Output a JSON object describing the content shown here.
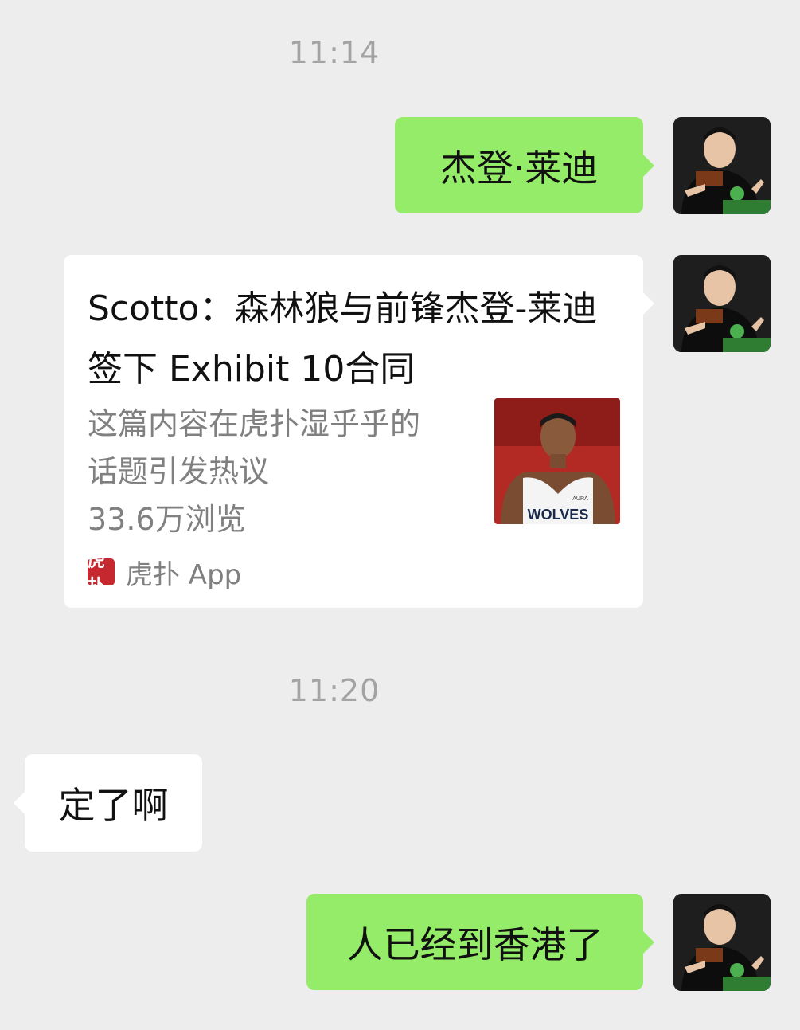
{
  "messages": {
    "timestamp_1": "11:14",
    "msg_1": "杰登·莱迪",
    "card": {
      "title": "Scotto：森林狼与前锋杰登-莱迪签下 Exhibit 10合同",
      "desc_line_1": "这篇内容在虎扑湿乎乎的",
      "desc_line_2": "话题引发热议",
      "desc_line_3": "33.6万浏览",
      "thumb_jersey_text": "WOLVES",
      "thumb_brand_text": "AURA",
      "source_logo_text": "虎扑",
      "source_name": "虎扑 App"
    },
    "timestamp_2": "11:20",
    "msg_2": "定了啊",
    "msg_3": "人已经到香港了"
  },
  "colors": {
    "background": "#ededed",
    "bubble_green": "#95ec69",
    "bubble_white": "#ffffff",
    "timestamp": "#a3a3a3",
    "hupu_red": "#c5282f"
  },
  "icons": {
    "avatar": "user-avatar-photo",
    "source_logo": "hupu-logo-icon",
    "thumbnail": "basketball-player-photo"
  }
}
